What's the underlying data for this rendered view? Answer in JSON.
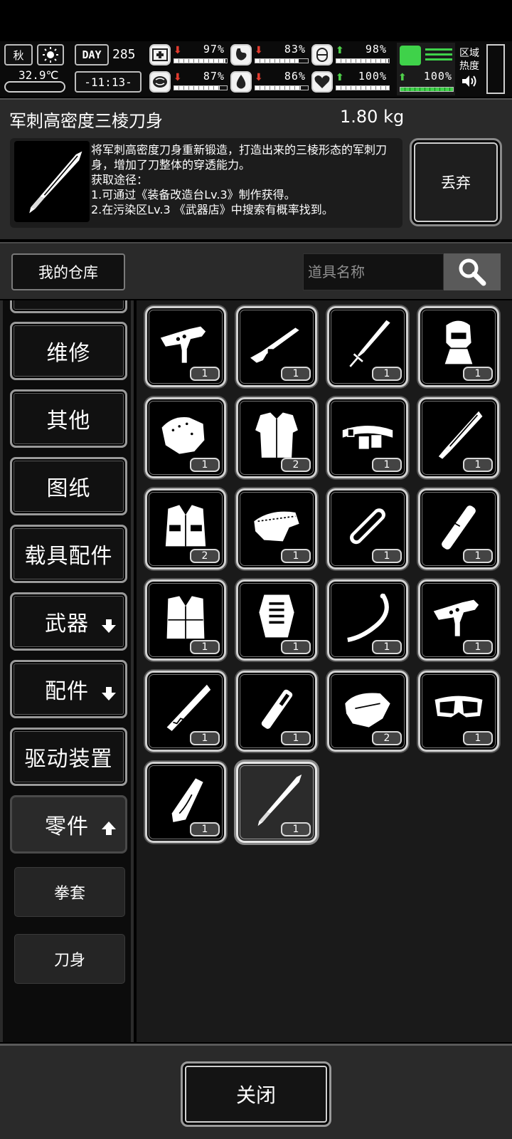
{
  "hud": {
    "season": "秋",
    "day_badge": "DAY",
    "day_number": "285",
    "temperature": "32.9℃",
    "time": "-11:13-",
    "zone_heat": "区域\n热度",
    "stats": [
      {
        "icon": "medkit-icon",
        "dir": "down",
        "pct": "97%",
        "value": 0.97
      },
      {
        "icon": "stomach-icon",
        "dir": "down",
        "pct": "83%",
        "value": 0.83
      },
      {
        "icon": "pill-icon",
        "dir": "up",
        "pct": "98%",
        "value": 0.98
      },
      {
        "icon": "brain-icon",
        "dir": "down",
        "pct": "87%",
        "value": 0.87
      },
      {
        "icon": "water-drop-icon",
        "dir": "down",
        "pct": "86%",
        "value": 0.86
      },
      {
        "icon": "heart-icon",
        "dir": "up",
        "pct": "100%",
        "value": 1.0
      }
    ],
    "stamina_pct": "100%",
    "stamina_value": 1.0
  },
  "item": {
    "name": "军刺高密度三棱刀身",
    "weight": "1.80 kg",
    "description": "将军刺高密度刀身重新锻造，打造出来的三棱形态的军刺刀身，增加了刀整体的穿透能力。\n获取途径：\n1.可通过《装备改造台Lv.3》制作获得。\n2.在污染区Lv.3 《武器店》中搜索有概率找到。",
    "discard_label": "丢弃"
  },
  "warehouse": {
    "label": "我的仓库",
    "search_placeholder": "道具名称"
  },
  "categories": [
    {
      "label": "维修"
    },
    {
      "label": "其他"
    },
    {
      "label": "图纸"
    },
    {
      "label": "载具配件"
    },
    {
      "label": "武器",
      "arrow": "down"
    },
    {
      "label": "配件",
      "arrow": "down"
    },
    {
      "label": "驱动装置"
    },
    {
      "label": "零件",
      "arrow": "up",
      "active": true
    }
  ],
  "subcategories": [
    {
      "label": "拳套"
    },
    {
      "label": "刀身"
    }
  ],
  "items": [
    {
      "icon": "gun-receiver-icon",
      "qty": "1"
    },
    {
      "icon": "rifle-icon",
      "qty": "1"
    },
    {
      "icon": "spearhead-icon",
      "qty": "1"
    },
    {
      "icon": "helmet-icon",
      "qty": "1"
    },
    {
      "icon": "shoulder-armor-icon",
      "qty": "1"
    },
    {
      "icon": "jacket-icon",
      "qty": "2"
    },
    {
      "icon": "utility-belt-icon",
      "qty": "1"
    },
    {
      "icon": "machete-icon",
      "qty": "1"
    },
    {
      "icon": "vest-icon",
      "qty": "2"
    },
    {
      "icon": "camo-gloves-icon",
      "qty": "1"
    },
    {
      "icon": "chainsaw-bar-icon",
      "qty": "1"
    },
    {
      "icon": "knife-handle-icon",
      "qty": "1"
    },
    {
      "icon": "padded-vest-icon",
      "qty": "1"
    },
    {
      "icon": "chest-armor-icon",
      "qty": "1"
    },
    {
      "icon": "bow-limb-icon",
      "qty": "1"
    },
    {
      "icon": "gun-receiver-icon",
      "qty": "1"
    },
    {
      "icon": "serrated-blade-icon",
      "qty": "1"
    },
    {
      "icon": "grip-handle-icon",
      "qty": "1"
    },
    {
      "icon": "gloves-icon",
      "qty": "2"
    },
    {
      "icon": "goggles-icon",
      "qty": "1"
    },
    {
      "icon": "wood-handle-icon",
      "qty": "1"
    },
    {
      "icon": "bayonet-blade-icon",
      "qty": "1",
      "selected": true
    }
  ],
  "footer": {
    "close_label": "关闭"
  }
}
